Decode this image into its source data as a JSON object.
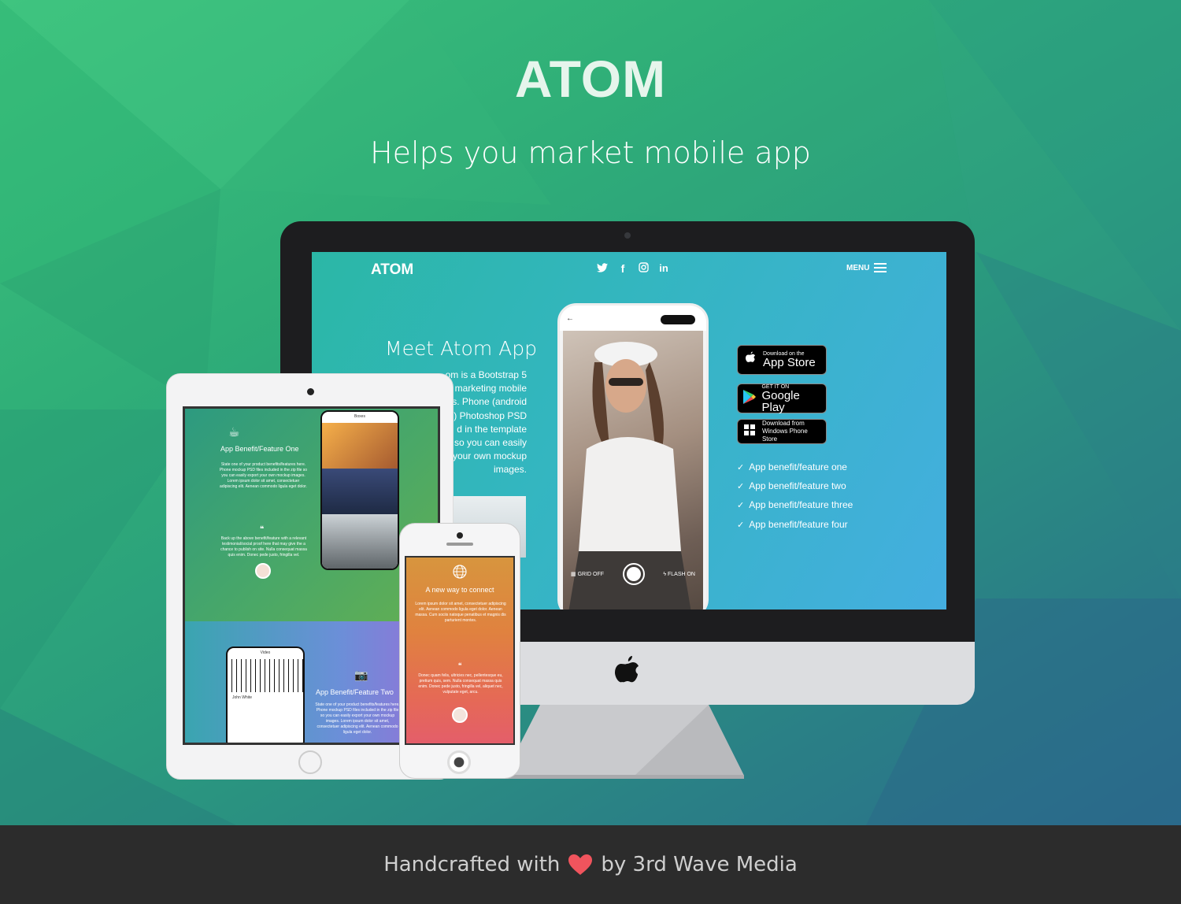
{
  "header": {
    "brand": "ATOM",
    "tagline": "Helps you market mobile app"
  },
  "desktop_site": {
    "logo": "ATOM",
    "social": [
      {
        "icon": "twitter-icon",
        "glyph": "🐦"
      },
      {
        "icon": "facebook-icon",
        "glyph": "f"
      },
      {
        "icon": "instagram-icon",
        "glyph": "◎"
      },
      {
        "icon": "linkedin-icon",
        "glyph": "in"
      }
    ],
    "menu_label": "MENU",
    "title": "Meet Atom App",
    "paragraph_lines": [
      "om is a Bootstrap 5",
      "marketing mobile",
      "s. Phone (android",
      "d) Photoshop PSD",
      "d in the template",
      "so you can easily",
      "your own mockup",
      "images."
    ],
    "phone": {
      "grid_label": "GRID OFF",
      "flash_label": "FLASH ON"
    },
    "stores": [
      {
        "icon": "apple-icon",
        "small": "Download on the",
        "big": "App Store"
      },
      {
        "icon": "google-play-icon",
        "small": "GET IT ON",
        "big": "Google Play"
      },
      {
        "icon": "windows-icon",
        "small": "Download from",
        "mid": "Windows Phone Store"
      }
    ],
    "features": [
      "App benefit/feature one",
      "App benefit/feature two",
      "App benefit/feature three",
      "App benefit/feature four"
    ]
  },
  "tablet_site": {
    "feature_one_title": "App Benefit/Feature One",
    "feature_one_text": "State one of your product benefits/features here. Phone mockup PSD files included in the zip file so you can easily export your own mockup images. Lorem ipsum dolor sit amet, consectetuer adipiscing elit. Aenean commodo ligula eget dolor.",
    "quote_text": "Back up the above benefit/feature with a relevant testimonial/social proof here that may give the a chance to publish on site. Nulla consequat massa quis enim. Donec pede justo, fringilla vel.",
    "phone_header": "Boxes",
    "feature_two_title": "App Benefit/Feature Two",
    "feature_two_text": "State one of your product benefits/features here. Phone mockup PSD files included in the zip file so you can easily export your own mockup images. Lorem ipsum dolor sit amet, consectetuer adipiscing elit. Aenean commodo ligula eget dolor.",
    "video_header": "Video",
    "commenter": "John White"
  },
  "phone_site": {
    "title": "A new way to connect",
    "text": "Lorem ipsum dolor sit amet, consectetuer adipiscing elit. Aenean commodo ligula eget dolor. Aenean massa. Cum sociis natoque penatibus et magnis dis parturient montes.",
    "quote": "Donec quam felis, ultricies nec, pellentesque eu, pretium quis, sem. Nulla consequat massa quis enim. Donec pede justo, fringilla vel, aliquet nec, vulputate eget, arcu."
  },
  "footer": {
    "before": "Handcrafted with",
    "after": "by 3rd Wave Media",
    "heart_color": "#f0545d"
  }
}
